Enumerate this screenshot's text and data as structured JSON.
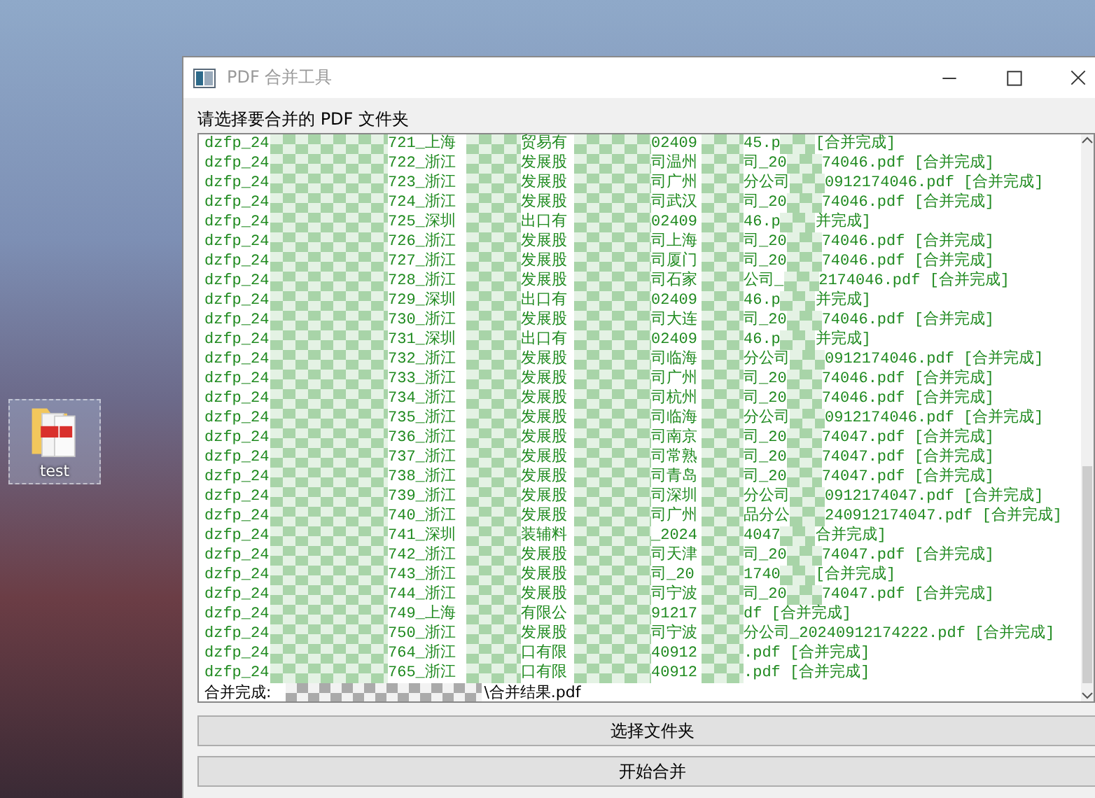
{
  "desktop": {
    "icons": [
      {
        "label": "test"
      }
    ]
  },
  "window": {
    "title": "PDF 合并工具",
    "prompt": "请选择要合并的 PDF 文件夹",
    "log": {
      "rows": [
        {
          "segments": [
            "dzfp_24",
            "721_上海",
            "贸易有",
            "02409",
            "45.p",
            "[合并完成]"
          ]
        },
        {
          "segments": [
            "dzfp_24",
            "722_浙江",
            "发展股",
            "司温州",
            "司_20",
            "74046.pdf [合并完成]"
          ]
        },
        {
          "segments": [
            "dzfp_24",
            "723_浙江",
            "发展股",
            "司广州",
            "分公司",
            "0912174046.pdf [合并完成]"
          ]
        },
        {
          "segments": [
            "dzfp_24",
            "724_浙江",
            "发展股",
            "司武汉",
            "司_20",
            "74046.pdf [合并完成]"
          ]
        },
        {
          "segments": [
            "dzfp_24",
            "725_深圳",
            "出口有",
            "02409",
            "46.p",
            "并完成]"
          ]
        },
        {
          "segments": [
            "dzfp_24",
            "726_浙江",
            "发展股",
            "司上海",
            "司_20",
            "74046.pdf [合并完成]"
          ]
        },
        {
          "segments": [
            "dzfp_24",
            "727_浙江",
            "发展股",
            "司厦门",
            "司_20",
            "74046.pdf [合并完成]"
          ]
        },
        {
          "segments": [
            "dzfp_24",
            "728_浙江",
            "发展股",
            "司石家",
            "公司_",
            "2174046.pdf [合并完成]"
          ]
        },
        {
          "segments": [
            "dzfp_24",
            "729_深圳",
            "出口有",
            "02409",
            "46.p",
            "并完成]"
          ]
        },
        {
          "segments": [
            "dzfp_24",
            "730_浙江",
            "发展股",
            "司大连",
            "司_20",
            "74046.pdf [合并完成]"
          ]
        },
        {
          "segments": [
            "dzfp_24",
            "731_深圳",
            "出口有",
            "02409",
            "46.p",
            "并完成]"
          ]
        },
        {
          "segments": [
            "dzfp_24",
            "732_浙江",
            "发展股",
            "司临海",
            "分公司",
            "0912174046.pdf [合并完成]"
          ]
        },
        {
          "segments": [
            "dzfp_24",
            "733_浙江",
            "发展股",
            "司广州",
            "司_20",
            "74046.pdf [合并完成]"
          ]
        },
        {
          "segments": [
            "dzfp_24",
            "734_浙江",
            "发展股",
            "司杭州",
            "司_20",
            "74046.pdf [合并完成]"
          ]
        },
        {
          "segments": [
            "dzfp_24",
            "735_浙江",
            "发展股",
            "司临海",
            "分公司",
            "0912174046.pdf [合并完成]"
          ]
        },
        {
          "segments": [
            "dzfp_24",
            "736_浙江",
            "发展股",
            "司南京",
            "司_20",
            "74047.pdf [合并完成]"
          ]
        },
        {
          "segments": [
            "dzfp_24",
            "737_浙江",
            "发展股",
            "司常熟",
            "司_20",
            "74047.pdf [合并完成]"
          ]
        },
        {
          "segments": [
            "dzfp_24",
            "738_浙江",
            "发展股",
            "司青岛",
            "司_20",
            "74047.pdf [合并完成]"
          ]
        },
        {
          "segments": [
            "dzfp_24",
            "739_浙江",
            "发展股",
            "司深圳",
            "分公司",
            "0912174047.pdf [合并完成]"
          ]
        },
        {
          "segments": [
            "dzfp_24",
            "740_浙江",
            "发展股",
            "司广州",
            "品分公",
            "240912174047.pdf [合并完成]"
          ]
        },
        {
          "segments": [
            "dzfp_24",
            "741_深圳",
            "装辅料",
            "_2024",
            "4047",
            "合并完成]"
          ]
        },
        {
          "segments": [
            "dzfp_24",
            "742_浙江",
            "发展股",
            "司天津",
            "司_20",
            "74047.pdf [合并完成]"
          ]
        },
        {
          "segments": [
            "dzfp_24",
            "743_浙江",
            "发展股",
            "司_20",
            "1740",
            "[合并完成]"
          ]
        },
        {
          "segments": [
            "dzfp_24",
            "744_浙江",
            "发展股",
            "司宁波",
            "司_20",
            "74047.pdf [合并完成]"
          ]
        },
        {
          "segments": [
            "dzfp_24",
            "749_上海",
            "有限公",
            "91217",
            "df [合并完成]"
          ]
        },
        {
          "segments": [
            "dzfp_24",
            "750_浙江",
            "发展股",
            "司宁波",
            "分公司_20240912174222.pdf [合并完成]"
          ]
        },
        {
          "segments": [
            "dzfp_24",
            "764_浙江",
            "口有限",
            "40912",
            ".pdf [合并完成]"
          ]
        },
        {
          "segments": [
            "dzfp_24",
            "765_浙江",
            "口有限",
            "40912",
            ".pdf [合并完成]"
          ]
        }
      ],
      "result": {
        "segments": [
          "合并完成:",
          "\\合并结果.pdf"
        ]
      }
    },
    "buttons": [
      {
        "label": "选择文件夹"
      },
      {
        "label": "开始合并"
      }
    ]
  }
}
